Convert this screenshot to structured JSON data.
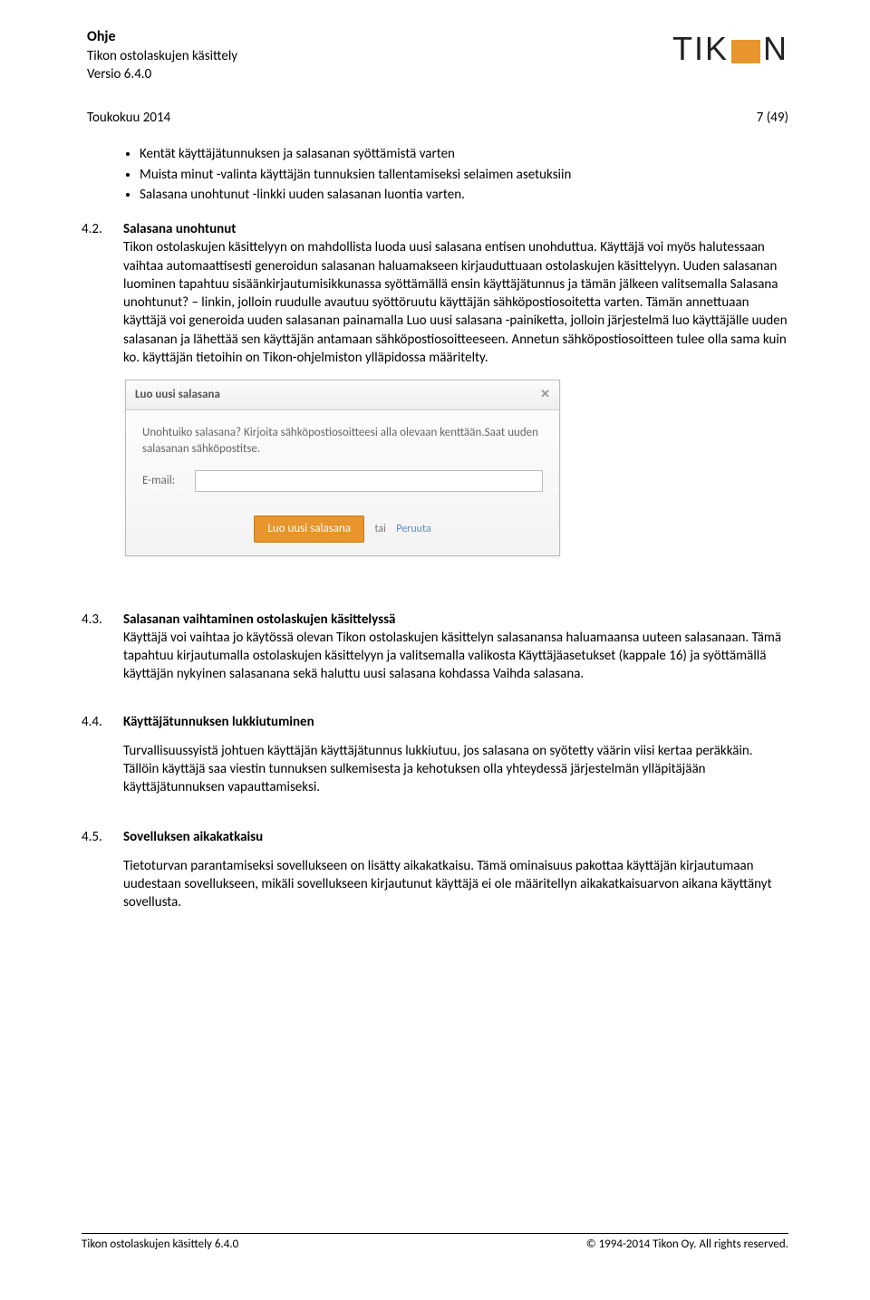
{
  "header": {
    "title": "Ohje",
    "subtitle": "Tikon ostolaskujen käsittely",
    "version": "Versio 6.4.0",
    "logo_text_left": "TIK",
    "logo_text_right": "N"
  },
  "page_meta": {
    "date": "Toukokuu 2014",
    "page": "7 (49)"
  },
  "bullets": [
    "Kentät käyttäjätunnuksen ja salasanan syöttämistä varten",
    "Muista minut -valinta käyttäjän tunnuksien tallentamiseksi selaimen asetuksiin",
    "Salasana unohtunut -linkki uuden salasanan luontia varten."
  ],
  "sections": {
    "s42": {
      "num": "4.2.",
      "title": "Salasana unohtunut",
      "body": "Tikon ostolaskujen käsittelyyn on mahdollista luoda uusi salasana entisen unohduttua. Käyttäjä voi myös halutessaan vaihtaa automaattisesti generoidun salasanan haluamakseen kirjauduttuaan ostolaskujen käsittelyyn. Uuden salasanan luominen tapahtuu sisäänkirjautumisikkunassa syöttämällä ensin käyttäjätunnus ja tämän jälkeen valitsemalla Salasana unohtunut? – linkin, jolloin ruudulle avautuu syöttöruutu käyttäjän sähköpostiosoitetta varten. Tämän annettuaan käyttäjä voi generoida uuden salasanan painamalla Luo uusi salasana -painiketta, jolloin järjestelmä luo käyttäjälle uuden salasanan ja lähettää sen käyttäjän antamaan sähköpostiosoitteeseen. Annetun sähköpostiosoitteen tulee olla sama kuin ko. käyttäjän tietoihin on Tikon-ohjelmiston ylläpidossa määritelty."
    },
    "s43": {
      "num": "4.3.",
      "title": "Salasanan vaihtaminen ostolaskujen käsittelyssä",
      "body": "Käyttäjä voi vaihtaa jo käytössä olevan Tikon ostolaskujen käsittelyn salasanansa haluamaansa uuteen salasanaan. Tämä tapahtuu kirjautumalla ostolaskujen käsittelyyn ja valitsemalla valikosta Käyttäjäasetukset (kappale 16) ja syöttämällä käyttäjän nykyinen salasanana sekä haluttu uusi salasana kohdassa Vaihda salasana."
    },
    "s44": {
      "num": "4.4.",
      "title": "Käyttäjätunnuksen lukkiutuminen",
      "body": "Turvallisuussyistä johtuen käyttäjän käyttäjätunnus lukkiutuu, jos salasana on syötetty väärin viisi kertaa peräkkäin. Tällöin käyttäjä saa viestin tunnuksen sulkemisesta ja kehotuksen olla yhteydessä järjestelmän ylläpitäjään käyttäjätunnuksen vapauttamiseksi."
    },
    "s45": {
      "num": "4.5.",
      "title": "Sovelluksen aikakatkaisu",
      "body": "Tietoturvan parantamiseksi sovellukseen on lisätty aikakatkaisu. Tämä ominaisuus pakottaa käyttäjän kirjautumaan uudestaan sovellukseen, mikäli sovellukseen kirjautunut käyttäjä ei ole määritellyn aikakatkaisuarvon aikana käyttänyt sovellusta."
    }
  },
  "dialog": {
    "title": "Luo uusi salasana",
    "close": "✕",
    "text": "Unohtuiko salasana? Kirjoita sähköpostiosoitteesi alla olevaan kenttään.Saat uuden salasanan sähköpostitse.",
    "email_label": "E-mail:",
    "button": "Luo uusi salasana",
    "or": "tai",
    "cancel": "Peruuta"
  },
  "footer": {
    "left": "Tikon ostolaskujen käsittely 6.4.0",
    "right": "© 1994-2014 Tikon Oy. All rights reserved."
  }
}
